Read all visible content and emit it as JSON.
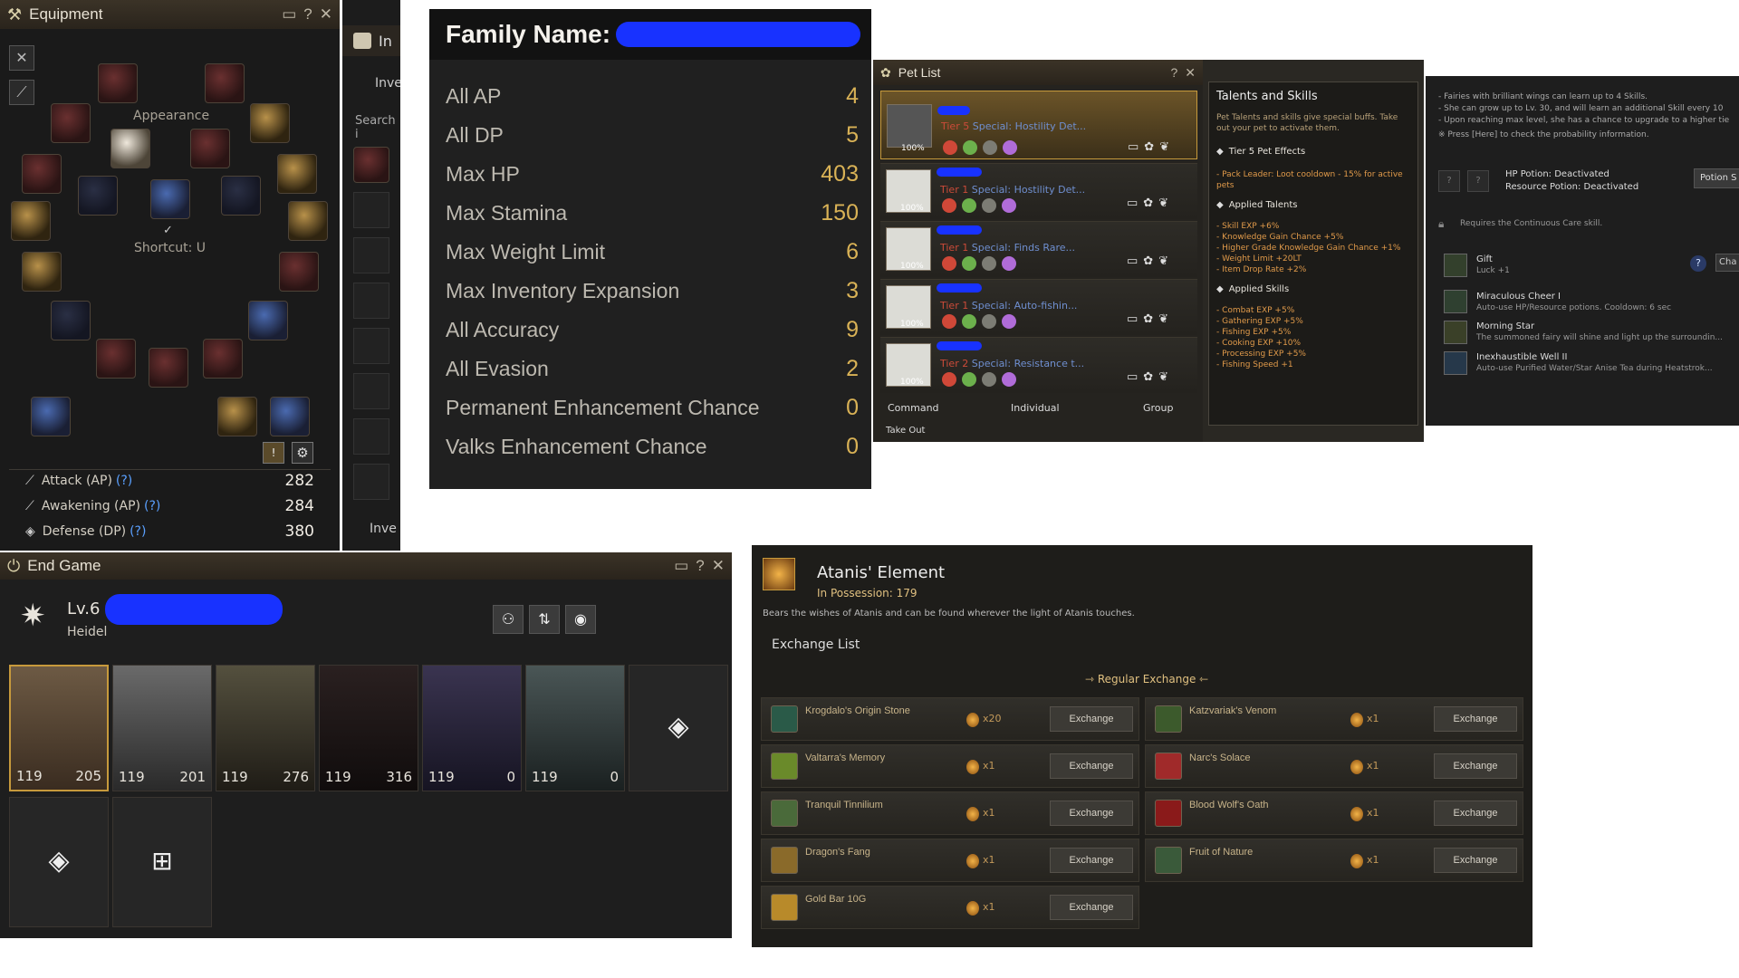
{
  "equipment": {
    "title": "Equipment",
    "appearance_label": "Appearance",
    "shortcut_label": "Shortcut: U",
    "stats": [
      {
        "label": "Attack (AP)",
        "help": "(?)",
        "value": "282"
      },
      {
        "label": "Awakening (AP)",
        "help": "(?)",
        "value": "284"
      },
      {
        "label": "Defense (DP)",
        "help": "(?)",
        "value": "380"
      }
    ]
  },
  "inventory_partial": {
    "tab_label": "In",
    "tab_label2": "Inve",
    "search_placeholder": "Search i",
    "footer_label": "Inve"
  },
  "family": {
    "title": "Family Name:",
    "rows": [
      {
        "label": "All AP",
        "value": "4"
      },
      {
        "label": "All DP",
        "value": "5"
      },
      {
        "label": "Max HP",
        "value": "403"
      },
      {
        "label": "Max Stamina",
        "value": "150"
      },
      {
        "label": "Max Weight Limit",
        "value": "6"
      },
      {
        "label": "Max Inventory Expansion",
        "value": "3"
      },
      {
        "label": "All Accuracy",
        "value": "9"
      },
      {
        "label": "All Evasion",
        "value": "2"
      },
      {
        "label": "Permanent Enhancement Chance",
        "value": "0"
      },
      {
        "label": "Valks Enhancement Chance",
        "value": "0"
      }
    ]
  },
  "pet_list": {
    "title": "Pet List",
    "pets": [
      {
        "tier": "Tier 5",
        "special": "Special: Hostility Det...",
        "hunger": "100%"
      },
      {
        "tier": "Tier 1",
        "special": "Special: Hostility Det...",
        "hunger": "100%"
      },
      {
        "tier": "Tier 1",
        "special": "Special: Finds Rare...",
        "hunger": "100%"
      },
      {
        "tier": "Tier 1",
        "special": "Special: Auto-fishin...",
        "hunger": "100%"
      },
      {
        "tier": "Tier 2",
        "special": "Special: Resistance t...",
        "hunger": "100%"
      }
    ],
    "command_label": "Command",
    "individual_label": "Individual",
    "group_label": "Group",
    "take_out_label": "Take Out"
  },
  "talents": {
    "title": "Talents and Skills",
    "intro": "Pet Talents and skills give special buffs. Take out your pet to activate them.",
    "tier_heading": "Tier 5 Pet Effects",
    "tier_effect": "- Pack Leader: Loot cooldown - 15% for active pets",
    "talents_heading": "Applied Talents",
    "talent_lines": [
      "- Skill EXP +6%",
      "- Knowledge Gain Chance +5%",
      "- Higher Grade Knowledge Gain Chance +1%",
      "- Weight Limit +20LT",
      "- Item Drop Rate +2%"
    ],
    "skills_heading": "Applied Skills",
    "skill_lines": [
      "- Combat EXP +5%",
      "- Gathering EXP +5%",
      "- Fishing EXP +5%",
      "- Cooking EXP +10%",
      "- Processing EXP +5%",
      "- Fishing Speed +1"
    ]
  },
  "fairy": {
    "lines": [
      "- Fairies with brilliant wings can learn up to 4 Skills.",
      "- She can grow up to Lv. 30, and will learn an additional Skill every 10",
      "- Upon reaching max level, she has a chance to upgrade to a higher tie",
      "※ Press [Here] to check the probability information."
    ],
    "hp_potion": "HP Potion: Deactivated",
    "resource_potion": "Resource Potion: Deactivated",
    "potion_button": "Potion S",
    "requires": "Requires the Continuous Care skill.",
    "skills": [
      {
        "name": "Gift",
        "desc": "Luck +1"
      },
      {
        "name": "Miraculous Cheer I",
        "desc": "Auto-use HP/Resource potions. Cooldown: 6 sec"
      },
      {
        "name": "Morning Star",
        "desc": "The summoned fairy will shine and light up the surroundin..."
      },
      {
        "name": "Inexhaustible Well II",
        "desc": "Auto-use Purified Water/Star Anise Tea during Heatstrok..."
      }
    ],
    "help_mark": "?",
    "char_button": "Cha"
  },
  "end_game": {
    "title": "End Game",
    "level": "Lv.6",
    "server": "Heidel",
    "characters": [
      {
        "level": "119",
        "energy": "205"
      },
      {
        "level": "119",
        "energy": "201"
      },
      {
        "level": "119",
        "energy": "276"
      },
      {
        "level": "119",
        "energy": "316"
      },
      {
        "level": "119",
        "energy": "0"
      },
      {
        "level": "119",
        "energy": "0"
      }
    ]
  },
  "atanis": {
    "title": "Atanis' Element",
    "possession": "In Possession: 179",
    "description": "Bears the wishes of Atanis and can be found wherever the light of Atanis touches.",
    "list_heading": "Exchange List",
    "regular_label": "Regular Exchange",
    "button_label": "Exchange",
    "items": [
      {
        "name": "Krogdalo's Origin Stone",
        "qty": "x20"
      },
      {
        "name": "Katzvariak's Venom",
        "qty": "x1"
      },
      {
        "name": "Valtarra's Memory",
        "qty": "x1"
      },
      {
        "name": "Narc's Solace",
        "qty": "x1"
      },
      {
        "name": "Tranquil Tinnilium",
        "qty": "x1"
      },
      {
        "name": "Blood Wolf's Oath",
        "qty": "x1"
      },
      {
        "name": "Dragon's Fang",
        "qty": "x1"
      },
      {
        "name": "Fruit of Nature",
        "qty": "x1"
      },
      {
        "name": "Gold Bar 10G",
        "qty": "x1"
      }
    ]
  }
}
